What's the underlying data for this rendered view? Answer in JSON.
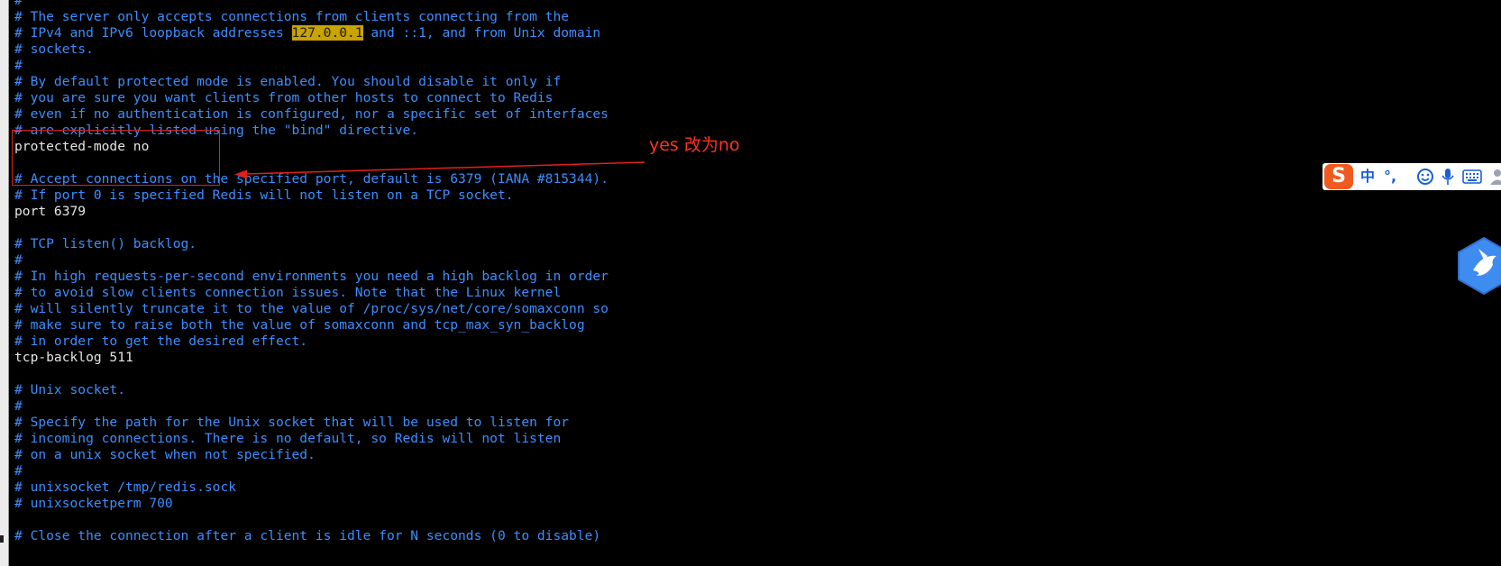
{
  "terminal": {
    "lines": [
      {
        "text": "#",
        "kind": "comment"
      },
      {
        "text": "# The server only accepts connections from clients connecting from the",
        "kind": "comment"
      },
      {
        "pre": "# IPv4 and IPv6 loopback addresses ",
        "hl": "127.0.0.1",
        "post": " and ::1, and from Unix domain",
        "kind": "comment-hl"
      },
      {
        "text": "# sockets.",
        "kind": "comment"
      },
      {
        "text": "#",
        "kind": "comment"
      },
      {
        "text": "# By default protected mode is enabled. You should disable it only if",
        "kind": "comment"
      },
      {
        "text": "# you are sure you want clients from other hosts to connect to Redis",
        "kind": "comment"
      },
      {
        "text": "# even if no authentication is configured, nor a specific set of interfaces",
        "kind": "comment"
      },
      {
        "text": "# are explicitly listed using the \"bind\" directive.",
        "kind": "comment"
      },
      {
        "text": "protected-mode no",
        "kind": "code"
      },
      {
        "text": "",
        "kind": "code"
      },
      {
        "text": "# Accept connections on the specified port, default is 6379 (IANA #815344).",
        "kind": "comment"
      },
      {
        "text": "# If port 0 is specified Redis will not listen on a TCP socket.",
        "kind": "comment"
      },
      {
        "text": "port 6379",
        "kind": "code"
      },
      {
        "text": "",
        "kind": "code"
      },
      {
        "text": "# TCP listen() backlog.",
        "kind": "comment"
      },
      {
        "text": "#",
        "kind": "comment"
      },
      {
        "text": "# In high requests-per-second environments you need a high backlog in order",
        "kind": "comment"
      },
      {
        "text": "# to avoid slow clients connection issues. Note that the Linux kernel",
        "kind": "comment"
      },
      {
        "text": "# will silently truncate it to the value of /proc/sys/net/core/somaxconn so",
        "kind": "comment"
      },
      {
        "text": "# make sure to raise both the value of somaxconn and tcp_max_syn_backlog",
        "kind": "comment"
      },
      {
        "text": "# in order to get the desired effect.",
        "kind": "comment"
      },
      {
        "text": "tcp-backlog 511",
        "kind": "code"
      },
      {
        "text": "",
        "kind": "code"
      },
      {
        "text": "# Unix socket.",
        "kind": "comment"
      },
      {
        "text": "#",
        "kind": "comment"
      },
      {
        "text": "# Specify the path for the Unix socket that will be used to listen for",
        "kind": "comment"
      },
      {
        "text": "# incoming connections. There is no default, so Redis will not listen",
        "kind": "comment"
      },
      {
        "text": "# on a unix socket when not specified.",
        "kind": "comment"
      },
      {
        "text": "#",
        "kind": "comment"
      },
      {
        "text": "# unixsocket /tmp/redis.sock",
        "kind": "comment"
      },
      {
        "text": "# unixsocketperm 700",
        "kind": "comment"
      },
      {
        "text": "",
        "kind": "code"
      },
      {
        "text": "# Close the connection after a client is idle for N seconds (0 to disable)",
        "kind": "comment"
      }
    ]
  },
  "annotation": {
    "text": "yes 改为no",
    "color": "#ff3322"
  },
  "ime_toolbar": {
    "logo": "S",
    "mode": "中",
    "punct": "°,",
    "icons": [
      "emoji-icon",
      "microphone-icon",
      "keyboard-icon",
      "user-icon"
    ]
  },
  "colors": {
    "comment": "#3d8eff",
    "code": "#e4e4e4",
    "highlight": "#c9a300",
    "annotation": "#e0201e"
  }
}
